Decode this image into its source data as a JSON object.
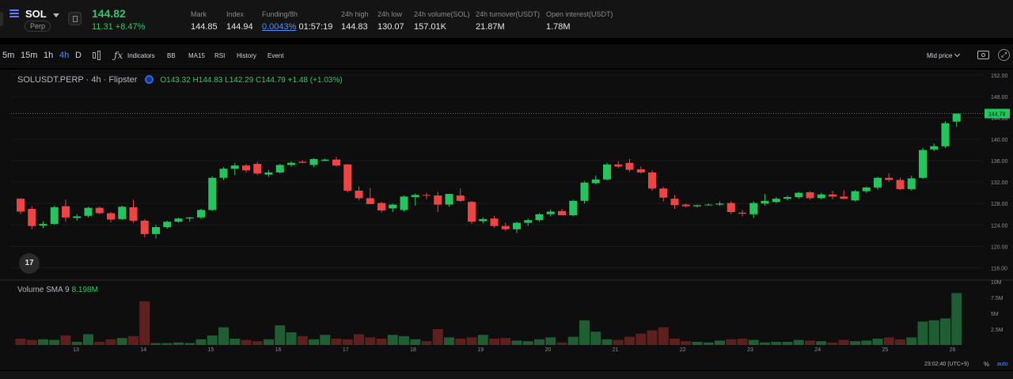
{
  "header": {
    "symbol": "SOL",
    "badge": "Perp",
    "last_price": "144.82",
    "change": "11.31 +8.47%",
    "stats": [
      {
        "label": "Mark",
        "value": "144.85"
      },
      {
        "label": "Index",
        "value": "144.94"
      },
      {
        "label": "Funding/8h",
        "value": "0.0043%",
        "extra": "01:57:19"
      },
      {
        "label": "24h high",
        "value": "144.83"
      },
      {
        "label": "24h low",
        "value": "130.07"
      },
      {
        "label": "24h volume(SOL)",
        "value": "157.01K"
      },
      {
        "label": "24h turnover(USDT)",
        "value": "21.87M"
      },
      {
        "label": "Open interest(USDT)",
        "value": "1.78M"
      }
    ]
  },
  "toolbar": {
    "intervals": [
      "5m",
      "15m",
      "1h",
      "4h",
      "D"
    ],
    "active_interval": "4h",
    "indicators_label": "Indicators",
    "studies": [
      "BB",
      "MA15",
      "RSI",
      "History",
      "Event"
    ],
    "price_source": "Mid price"
  },
  "legend": {
    "title": "SOLUSDT.PERP · 4h · Flipster",
    "ohlc": "O143.32 H144.83 L142.29 C144.79 +1.48 (+1.03%)"
  },
  "volume_legend": {
    "label": "Volume SMA 9",
    "value": "8.198M"
  },
  "logo_text": "17",
  "status": {
    "clock": "23:02:40 (UTC+9)",
    "percent": "%",
    "auto": "auto"
  },
  "colors": {
    "up": "#26a69a",
    "up_bright": "#22c55e",
    "down": "#ef4444",
    "accent": "#4f8ff7"
  },
  "chart_data": {
    "type": "candlestick",
    "title": "",
    "price_axis": {
      "min": 114,
      "max": 153,
      "ticks": [
        116,
        120,
        124,
        128,
        132,
        136,
        140,
        144,
        148,
        152
      ]
    },
    "volume_axis": {
      "max": 10,
      "ticks": [
        "10M",
        "7.5M",
        "5M",
        "2.5M"
      ],
      "tick_values": [
        10,
        7.5,
        5,
        2.5
      ]
    },
    "x_ticks": [
      "13",
      "14",
      "15",
      "16",
      "17",
      "18",
      "19",
      "20",
      "21",
      "22",
      "23",
      "24",
      "25",
      "26"
    ],
    "last_price_label": "144.79",
    "candles": [
      {
        "o": 128.9,
        "h": 129.0,
        "l": 126.0,
        "c": 126.5,
        "v": 1.0
      },
      {
        "o": 127.0,
        "h": 127.5,
        "l": 123.2,
        "c": 123.8,
        "v": 0.8
      },
      {
        "o": 123.9,
        "h": 124.7,
        "l": 123.4,
        "c": 124.2,
        "v": 0.9
      },
      {
        "o": 124.2,
        "h": 127.6,
        "l": 124.0,
        "c": 127.3,
        "v": 0.8
      },
      {
        "o": 127.5,
        "h": 128.7,
        "l": 124.6,
        "c": 125.4,
        "v": 1.5
      },
      {
        "o": 125.3,
        "h": 126.0,
        "l": 124.8,
        "c": 125.6,
        "v": 0.5
      },
      {
        "o": 125.7,
        "h": 127.4,
        "l": 125.4,
        "c": 127.2,
        "v": 1.7
      },
      {
        "o": 127.2,
        "h": 127.4,
        "l": 126.0,
        "c": 126.2,
        "v": 0.5
      },
      {
        "o": 126.2,
        "h": 126.4,
        "l": 124.5,
        "c": 125.0,
        "v": 0.9
      },
      {
        "o": 125.1,
        "h": 127.6,
        "l": 124.9,
        "c": 127.4,
        "v": 1.1
      },
      {
        "o": 127.3,
        "h": 128.7,
        "l": 124.4,
        "c": 124.8,
        "v": 1.4
      },
      {
        "o": 124.8,
        "h": 125.1,
        "l": 121.7,
        "c": 122.3,
        "v": 6.9
      },
      {
        "o": 122.3,
        "h": 124.0,
        "l": 121.5,
        "c": 123.6,
        "v": 0.3
      },
      {
        "o": 123.6,
        "h": 124.8,
        "l": 123.3,
        "c": 124.6,
        "v": 0.3
      },
      {
        "o": 124.6,
        "h": 125.4,
        "l": 124.4,
        "c": 125.2,
        "v": 0.4
      },
      {
        "o": 125.2,
        "h": 125.5,
        "l": 124.6,
        "c": 125.4,
        "v": 0.3
      },
      {
        "o": 125.4,
        "h": 127.0,
        "l": 125.1,
        "c": 126.8,
        "v": 0.9
      },
      {
        "o": 126.8,
        "h": 133.1,
        "l": 126.6,
        "c": 132.8,
        "v": 1.5
      },
      {
        "o": 132.8,
        "h": 134.8,
        "l": 132.4,
        "c": 134.5,
        "v": 2.8
      },
      {
        "o": 134.5,
        "h": 135.6,
        "l": 133.3,
        "c": 135.1,
        "v": 1.0
      },
      {
        "o": 135.1,
        "h": 135.4,
        "l": 133.8,
        "c": 134.2,
        "v": 0.8
      },
      {
        "o": 135.4,
        "h": 135.8,
        "l": 133.3,
        "c": 133.6,
        "v": 0.6
      },
      {
        "o": 133.4,
        "h": 134.3,
        "l": 133.0,
        "c": 133.8,
        "v": 0.9
      },
      {
        "o": 133.8,
        "h": 135.4,
        "l": 133.6,
        "c": 135.2,
        "v": 3.1
      },
      {
        "o": 135.2,
        "h": 135.9,
        "l": 134.9,
        "c": 135.6,
        "v": 2.0
      },
      {
        "o": 135.8,
        "h": 136.1,
        "l": 135.5,
        "c": 135.6,
        "v": 1.4
      },
      {
        "o": 135.2,
        "h": 136.5,
        "l": 134.8,
        "c": 136.3,
        "v": 0.9
      },
      {
        "o": 136.0,
        "h": 136.4,
        "l": 135.9,
        "c": 136.2,
        "v": 1.6
      },
      {
        "o": 136.2,
        "h": 136.7,
        "l": 134.9,
        "c": 135.1,
        "v": 1.0
      },
      {
        "o": 135.3,
        "h": 135.4,
        "l": 130.1,
        "c": 130.4,
        "v": 0.9
      },
      {
        "o": 130.4,
        "h": 131.2,
        "l": 128.6,
        "c": 129.0,
        "v": 1.7
      },
      {
        "o": 129.0,
        "h": 130.9,
        "l": 127.9,
        "c": 127.9,
        "v": 1.2
      },
      {
        "o": 128.1,
        "h": 128.3,
        "l": 126.3,
        "c": 126.7,
        "v": 1.0
      },
      {
        "o": 127.1,
        "h": 128.0,
        "l": 126.4,
        "c": 127.8,
        "v": 1.6
      },
      {
        "o": 126.8,
        "h": 129.5,
        "l": 126.5,
        "c": 129.3,
        "v": 1.4
      },
      {
        "o": 129.2,
        "h": 129.9,
        "l": 127.6,
        "c": 129.6,
        "v": 0.9
      },
      {
        "o": 129.6,
        "h": 130.0,
        "l": 128.8,
        "c": 129.5,
        "v": 0.6
      },
      {
        "o": 129.5,
        "h": 130.2,
        "l": 126.4,
        "c": 127.8,
        "v": 2.5
      },
      {
        "o": 127.8,
        "h": 129.5,
        "l": 127.4,
        "c": 129.8,
        "v": 1.2
      },
      {
        "o": 129.5,
        "h": 130.8,
        "l": 128.3,
        "c": 128.5,
        "v": 1.0
      },
      {
        "o": 128.3,
        "h": 128.5,
        "l": 124.2,
        "c": 124.6,
        "v": 1.2
      },
      {
        "o": 124.7,
        "h": 125.4,
        "l": 124.3,
        "c": 125.1,
        "v": 1.6
      },
      {
        "o": 125.2,
        "h": 125.7,
        "l": 123.5,
        "c": 123.8,
        "v": 1.0
      },
      {
        "o": 123.8,
        "h": 124.4,
        "l": 122.9,
        "c": 123.2,
        "v": 1.1
      },
      {
        "o": 123.2,
        "h": 124.6,
        "l": 122.5,
        "c": 124.4,
        "v": 0.7
      },
      {
        "o": 124.4,
        "h": 125.2,
        "l": 123.8,
        "c": 124.9,
        "v": 0.6
      },
      {
        "o": 124.9,
        "h": 126.2,
        "l": 124.6,
        "c": 126.0,
        "v": 0.9
      },
      {
        "o": 126.0,
        "h": 126.9,
        "l": 125.6,
        "c": 126.5,
        "v": 1.2
      },
      {
        "o": 126.6,
        "h": 127.0,
        "l": 126.0,
        "c": 125.8,
        "v": 0.4
      },
      {
        "o": 125.8,
        "h": 128.7,
        "l": 125.6,
        "c": 128.5,
        "v": 1.3
      },
      {
        "o": 128.5,
        "h": 132.2,
        "l": 128.0,
        "c": 131.9,
        "v": 3.9
      },
      {
        "o": 131.8,
        "h": 133.2,
        "l": 131.6,
        "c": 132.5,
        "v": 2.1
      },
      {
        "o": 132.5,
        "h": 135.6,
        "l": 132.3,
        "c": 135.3,
        "v": 0.9
      },
      {
        "o": 135.3,
        "h": 135.9,
        "l": 134.6,
        "c": 134.9,
        "v": 0.8
      },
      {
        "o": 135.6,
        "h": 136.3,
        "l": 133.9,
        "c": 134.3,
        "v": 1.3
      },
      {
        "o": 134.4,
        "h": 134.9,
        "l": 133.6,
        "c": 133.8,
        "v": 1.8
      },
      {
        "o": 133.8,
        "h": 134.2,
        "l": 130.4,
        "c": 130.8,
        "v": 2.3
      },
      {
        "o": 130.8,
        "h": 131.1,
        "l": 128.4,
        "c": 129.1,
        "v": 2.8
      },
      {
        "o": 128.9,
        "h": 129.6,
        "l": 127.0,
        "c": 127.7,
        "v": 1.0
      },
      {
        "o": 127.8,
        "h": 128.0,
        "l": 127.3,
        "c": 127.5,
        "v": 0.6
      },
      {
        "o": 127.5,
        "h": 127.8,
        "l": 127.3,
        "c": 127.7,
        "v": 0.5
      },
      {
        "o": 127.7,
        "h": 128.0,
        "l": 127.6,
        "c": 127.8,
        "v": 0.4
      },
      {
        "o": 127.8,
        "h": 128.4,
        "l": 127.6,
        "c": 128.0,
        "v": 0.7
      },
      {
        "o": 128.1,
        "h": 128.4,
        "l": 126.0,
        "c": 126.4,
        "v": 0.9
      },
      {
        "o": 126.3,
        "h": 126.8,
        "l": 125.6,
        "c": 126.1,
        "v": 1.0
      },
      {
        "o": 126.0,
        "h": 128.4,
        "l": 125.3,
        "c": 128.1,
        "v": 0.8
      },
      {
        "o": 128.0,
        "h": 129.8,
        "l": 127.6,
        "c": 128.5,
        "v": 0.4
      },
      {
        "o": 128.3,
        "h": 129.2,
        "l": 128.1,
        "c": 128.9,
        "v": 0.5
      },
      {
        "o": 128.9,
        "h": 129.5,
        "l": 128.6,
        "c": 129.2,
        "v": 0.5
      },
      {
        "o": 129.2,
        "h": 130.2,
        "l": 128.9,
        "c": 130.0,
        "v": 0.8
      },
      {
        "o": 130.1,
        "h": 130.3,
        "l": 128.7,
        "c": 129.0,
        "v": 0.7
      },
      {
        "o": 129.0,
        "h": 130.0,
        "l": 128.8,
        "c": 129.7,
        "v": 0.6
      },
      {
        "o": 129.7,
        "h": 130.4,
        "l": 128.8,
        "c": 129.3,
        "v": 0.4
      },
      {
        "o": 129.3,
        "h": 130.5,
        "l": 128.8,
        "c": 128.9,
        "v": 0.8
      },
      {
        "o": 128.6,
        "h": 130.5,
        "l": 128.4,
        "c": 130.3,
        "v": 0.6
      },
      {
        "o": 130.3,
        "h": 131.2,
        "l": 130.0,
        "c": 131.0,
        "v": 0.7
      },
      {
        "o": 131.0,
        "h": 133.0,
        "l": 130.6,
        "c": 132.8,
        "v": 1.0
      },
      {
        "o": 132.8,
        "h": 133.6,
        "l": 132.1,
        "c": 132.4,
        "v": 1.2
      },
      {
        "o": 132.4,
        "h": 132.8,
        "l": 130.5,
        "c": 130.7,
        "v": 0.9
      },
      {
        "o": 130.7,
        "h": 133.2,
        "l": 130.4,
        "c": 132.7,
        "v": 1.2
      },
      {
        "o": 132.8,
        "h": 138.4,
        "l": 132.6,
        "c": 138.0,
        "v": 3.7
      },
      {
        "o": 138.1,
        "h": 139.2,
        "l": 137.8,
        "c": 138.7,
        "v": 3.9
      },
      {
        "o": 138.7,
        "h": 143.4,
        "l": 138.4,
        "c": 143.0,
        "v": 4.2
      },
      {
        "o": 143.3,
        "h": 144.8,
        "l": 142.3,
        "c": 144.8,
        "v": 8.2
      }
    ]
  }
}
